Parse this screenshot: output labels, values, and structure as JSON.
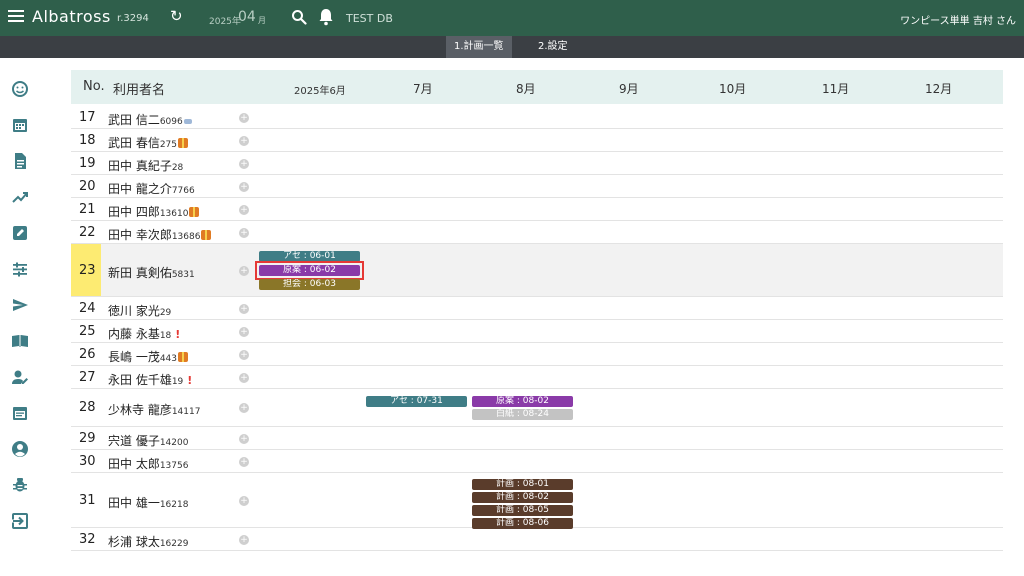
{
  "topbar": {
    "title": "Albatross",
    "revision": "r.3294",
    "year": "2025年",
    "month": "04",
    "month_unit": "月",
    "db_name": "TEST DB",
    "user": "ワンピース単単 吉村 さん"
  },
  "tabs": [
    {
      "label": "1.計画一覧",
      "active": true
    },
    {
      "label": "2.設定",
      "active": false
    }
  ],
  "sidebar_icons": [
    "smile-icon",
    "calendar-icon",
    "document-icon",
    "trending-icon",
    "edit-icon",
    "tune-icon",
    "send-icon",
    "book-icon",
    "person-edit-icon",
    "event-note-icon",
    "account-circle-icon",
    "bug-icon",
    "logout-icon"
  ],
  "grid": {
    "col_no": "No.",
    "col_name": "利用者名",
    "months": [
      "2025年6月",
      "7月",
      "8月",
      "9月",
      "10月",
      "11月",
      "12月"
    ]
  },
  "rows": [
    {
      "no": "17",
      "name": "武田 信二",
      "id": "6096",
      "badge": "mark"
    },
    {
      "no": "18",
      "name": "武田 春信",
      "id": "275",
      "badge": "gift"
    },
    {
      "no": "19",
      "name": "田中 真紀子",
      "id": "28",
      "badge": ""
    },
    {
      "no": "20",
      "name": "田中 龍之介",
      "id": "7766",
      "badge": ""
    },
    {
      "no": "21",
      "name": "田中 四郎",
      "id": "13610",
      "badge": "gift"
    },
    {
      "no": "22",
      "name": "田中 幸次郎",
      "id": "13686",
      "badge": "gift"
    },
    {
      "no": "23",
      "name": "新田 真剣佑",
      "id": "5831",
      "badge": "",
      "selected": true
    },
    {
      "no": "24",
      "name": "徳川 家光",
      "id": "29",
      "badge": ""
    },
    {
      "no": "25",
      "name": "内藤 永基",
      "id": "18",
      "badge": "excl"
    },
    {
      "no": "26",
      "name": "長嶋 一茂",
      "id": "443",
      "badge": "gift"
    },
    {
      "no": "27",
      "name": "永田 佐千雄",
      "id": "19",
      "badge": "excl"
    },
    {
      "no": "28",
      "name": "少林寺 龍彦",
      "id": "14117",
      "badge": ""
    },
    {
      "no": "29",
      "name": "宍道 優子",
      "id": "14200",
      "badge": ""
    },
    {
      "no": "30",
      "name": "田中 太郎",
      "id": "13756",
      "badge": ""
    },
    {
      "no": "31",
      "name": "田中 雄一",
      "id": "16218",
      "badge": ""
    },
    {
      "no": "32",
      "name": "杉浦 球太",
      "id": "16229",
      "badge": ""
    }
  ],
  "events": {
    "row23": [
      {
        "label": "アセ : 06-01",
        "kind": "ase"
      },
      {
        "label": "原案 : 06-02",
        "kind": "genan",
        "highlighted": true
      },
      {
        "label": "担会 : 06-03",
        "kind": "tankai"
      }
    ],
    "row28": [
      {
        "label": "アセ : 07-31",
        "kind": "ase"
      },
      {
        "label": "原案 : 08-02",
        "kind": "genan"
      },
      {
        "label": "白紙 : 08-24",
        "kind": "hakushi"
      }
    ],
    "row31": [
      {
        "label": "計画 : 08-01",
        "kind": "keikaku"
      },
      {
        "label": "計画 : 08-02",
        "kind": "keikaku"
      },
      {
        "label": "計画 : 08-05",
        "kind": "keikaku"
      },
      {
        "label": "計画 : 08-06",
        "kind": "keikaku"
      }
    ]
  },
  "colors": {
    "topbar": "#2f5f4b",
    "tabbar": "#3b3f44",
    "header": "#e4f1ef",
    "highlight_number": "#fdeb72",
    "highlight_box": "#e53935"
  }
}
